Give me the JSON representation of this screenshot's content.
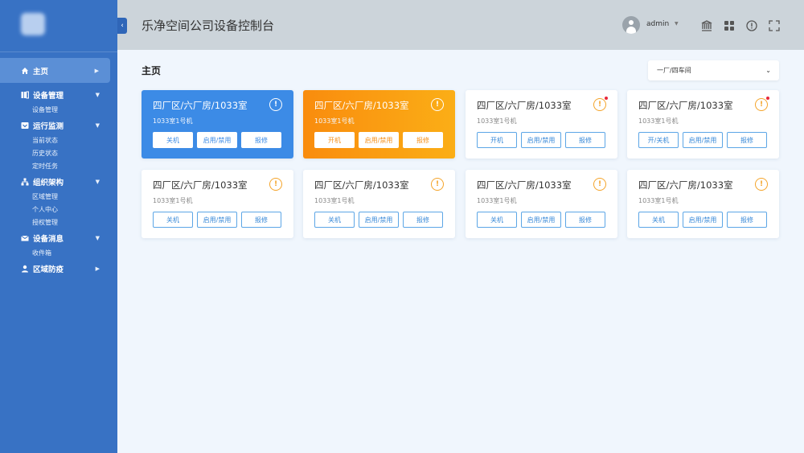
{
  "header": {
    "title": "乐净空间公司设备控制台",
    "username": "admin"
  },
  "sidebar": {
    "collapse_icon": "chevron-left-icon",
    "groups": [
      {
        "label": "主页",
        "icon": "home-icon",
        "items": []
      },
      {
        "label": "设备管理",
        "icon": "device-icon",
        "items": [
          "设备管理"
        ]
      },
      {
        "label": "运行监测",
        "icon": "monitor-icon",
        "items": [
          "当前状态",
          "历史状态",
          "定时任务"
        ]
      },
      {
        "label": "组织架构",
        "icon": "org-icon",
        "items": [
          "区域管理",
          "个人中心",
          "授权管理"
        ]
      },
      {
        "label": "设备消息",
        "icon": "mail-icon",
        "items": [
          "收件箱"
        ]
      },
      {
        "label": "区域防疫",
        "icon": "person-icon",
        "items": []
      }
    ]
  },
  "main": {
    "page_title": "主页",
    "select_value": "一厂/四车间",
    "cards": [
      {
        "title": "四厂区/六厂房/1033室",
        "sub": "1033室1号机",
        "buttons": [
          "关机",
          "启用/禁用",
          "报修"
        ],
        "style": "blue",
        "dot": false
      },
      {
        "title": "四厂区/六厂房/1033室",
        "sub": "1033室1号机",
        "buttons": [
          "开机",
          "启用/禁用",
          "报修"
        ],
        "style": "orange",
        "dot": false
      },
      {
        "title": "四厂区/六厂房/1033室",
        "sub": "1033室1号机",
        "buttons": [
          "开机",
          "启用/禁用",
          "报修"
        ],
        "style": "white",
        "dot": true
      },
      {
        "title": "四厂区/六厂房/1033室",
        "sub": "1033室1号机",
        "buttons": [
          "开/关机",
          "启用/禁用",
          "报修"
        ],
        "style": "white",
        "dot": true
      },
      {
        "title": "四厂区/六厂房/1033室",
        "sub": "1033室1号机",
        "buttons": [
          "关机",
          "启用/禁用",
          "报修"
        ],
        "style": "white",
        "dot": false
      },
      {
        "title": "四厂区/六厂房/1033室",
        "sub": "1033室1号机",
        "buttons": [
          "关机",
          "启用/禁用",
          "报修"
        ],
        "style": "white",
        "dot": false
      },
      {
        "title": "四厂区/六厂房/1033室",
        "sub": "1033室1号机",
        "buttons": [
          "关机",
          "启用/禁用",
          "报修"
        ],
        "style": "white",
        "dot": false
      },
      {
        "title": "四厂区/六厂房/1033室",
        "sub": "1033室1号机",
        "buttons": [
          "关机",
          "启用/禁用",
          "报修"
        ],
        "style": "white",
        "dot": false
      }
    ]
  },
  "colors": {
    "sidebar": "#3872c4",
    "active_nav": "#5b8fd6",
    "card_blue": "#3c8be6",
    "card_orange": "#f98c0e",
    "warning": "#f4a42a",
    "alert_dot": "#e8293a"
  }
}
